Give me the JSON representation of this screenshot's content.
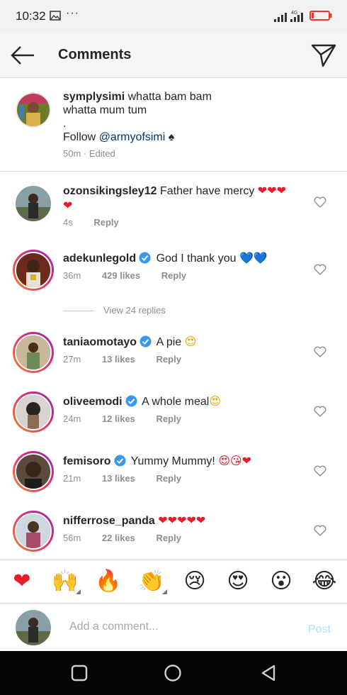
{
  "status_bar": {
    "time": "10:32",
    "dots": "···",
    "network": "4G"
  },
  "header": {
    "title": "Comments"
  },
  "caption": {
    "username": "symplysimi",
    "line1": "whatta bam bam",
    "line2": "whatta mum tum",
    "line3": ".",
    "follow_text": "Follow",
    "mention": "@armyofsimi",
    "suit": "♠",
    "meta": "50m · Edited"
  },
  "comments": [
    {
      "username": "ozonsikingsley12",
      "verified": false,
      "text": "Father have mercy",
      "emoji": "❤❤❤",
      "emoji2": "❤",
      "time": "4s",
      "likes": "",
      "reply": "Reply"
    },
    {
      "username": "adekunlegold",
      "verified": true,
      "text": "God I thank you",
      "emoji": "💙💙",
      "time": "36m",
      "likes": "429 likes",
      "reply": "Reply"
    },
    {
      "username": "taniaomotayo",
      "verified": true,
      "text": "A pie",
      "emoji": "😍",
      "time": "27m",
      "likes": "13 likes",
      "reply": "Reply"
    },
    {
      "username": "oliveemodi",
      "verified": true,
      "text": "A whole meal",
      "emoji": "😍",
      "time": "24m",
      "likes": "12 likes",
      "reply": "Reply"
    },
    {
      "username": "femisoro",
      "verified": true,
      "text": "Yummy Mummy!",
      "emoji": "😍😘❤",
      "time": "21m",
      "likes": "13 likes",
      "reply": "Reply"
    },
    {
      "username": "nifferrose_panda",
      "verified": false,
      "text": "",
      "emoji": "❤❤❤❤❤",
      "time": "56m",
      "likes": "22 likes",
      "reply": "Reply"
    }
  ],
  "view_replies": "View 24 replies",
  "quick_emojis": [
    "❤",
    "🙌",
    "🔥",
    "👏",
    "😢",
    "😍",
    "😮",
    "😂"
  ],
  "composer": {
    "placeholder": "Add a comment...",
    "post_label": "Post"
  },
  "colors": {
    "accent_link": "#003569",
    "post_disabled": "#b2dffc",
    "heart_red": "#e41e2b",
    "verified_blue": "#3897f0"
  }
}
